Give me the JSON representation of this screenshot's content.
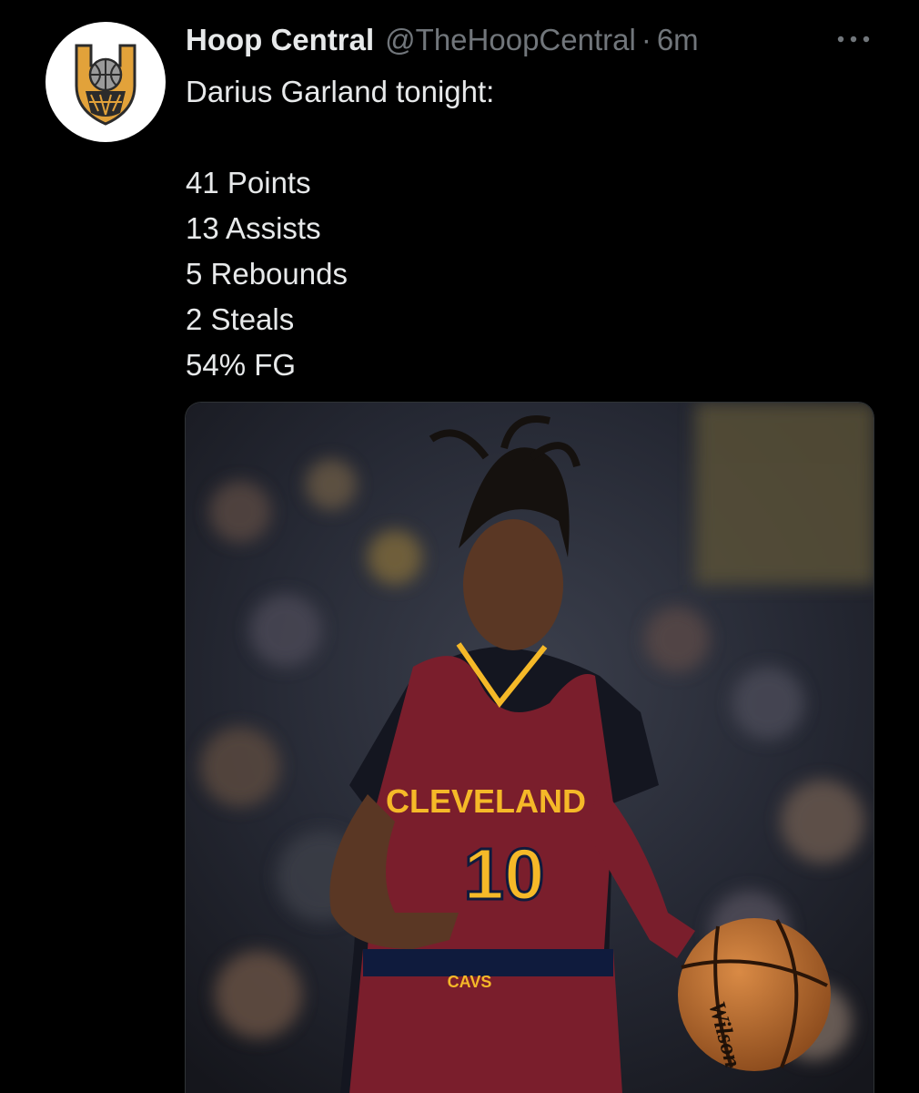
{
  "author": {
    "display_name": "Hoop Central",
    "handle": "@TheHoopCentral",
    "separator": "·",
    "time": "6m",
    "avatar_icon": "hoop-central-logo"
  },
  "menu": {
    "icon": "more-horizontal-icon"
  },
  "tweet": {
    "intro": "Darius Garland tonight:",
    "stats": [
      "41 Points",
      "13 Assists",
      "5 Rebounds",
      "2 Steals",
      "54% FG"
    ]
  },
  "media": {
    "jersey_text": "CLEVELAND",
    "jersey_number": "10",
    "waistband_text": "CAVS",
    "ball_text": "Wilson",
    "colors": {
      "wine": "#7a1e2c",
      "gold": "#f5b928",
      "navy": "#0f1b3d"
    }
  },
  "colors": {
    "background": "#000000",
    "primary_text": "#e7e9ea",
    "secondary_text": "#71767b",
    "logo_gold": "#e2a23a",
    "logo_dark": "#2b2b2b"
  }
}
